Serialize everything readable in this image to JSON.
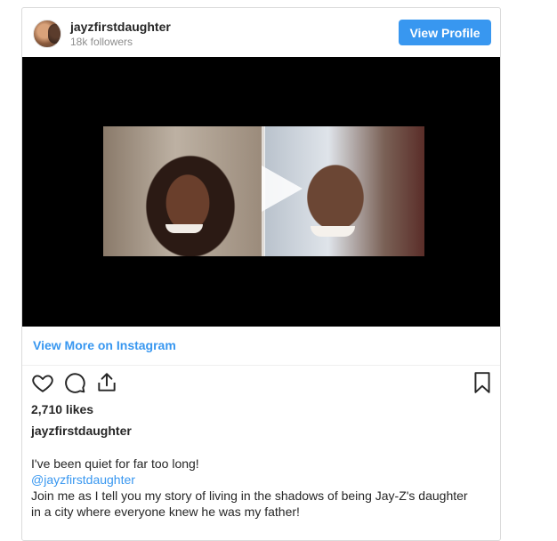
{
  "header": {
    "username": "jayzfirstdaughter",
    "followers": "18k followers",
    "view_profile_label": "View Profile"
  },
  "media": {
    "type": "video",
    "play_icon": "play-icon"
  },
  "view_more_label": "View More on Instagram",
  "actions": {
    "like_icon": "heart-icon",
    "comment_icon": "comment-icon",
    "share_icon": "share-icon",
    "save_icon": "bookmark-icon"
  },
  "likes": "2,710 likes",
  "caption": {
    "username": "jayzfirstdaughter",
    "line1": "I've been quiet for far too long!",
    "mention": "@jayzfirstdaughter",
    "line3": "Join me as I tell you my story of living in the shadows of being Jay-Z's daughter",
    "line4": "in a city where everyone knew he was my father!"
  },
  "colors": {
    "accent": "#3897f0",
    "text": "#262626",
    "muted": "#8e8e8e",
    "border": "#dbdbdb"
  }
}
